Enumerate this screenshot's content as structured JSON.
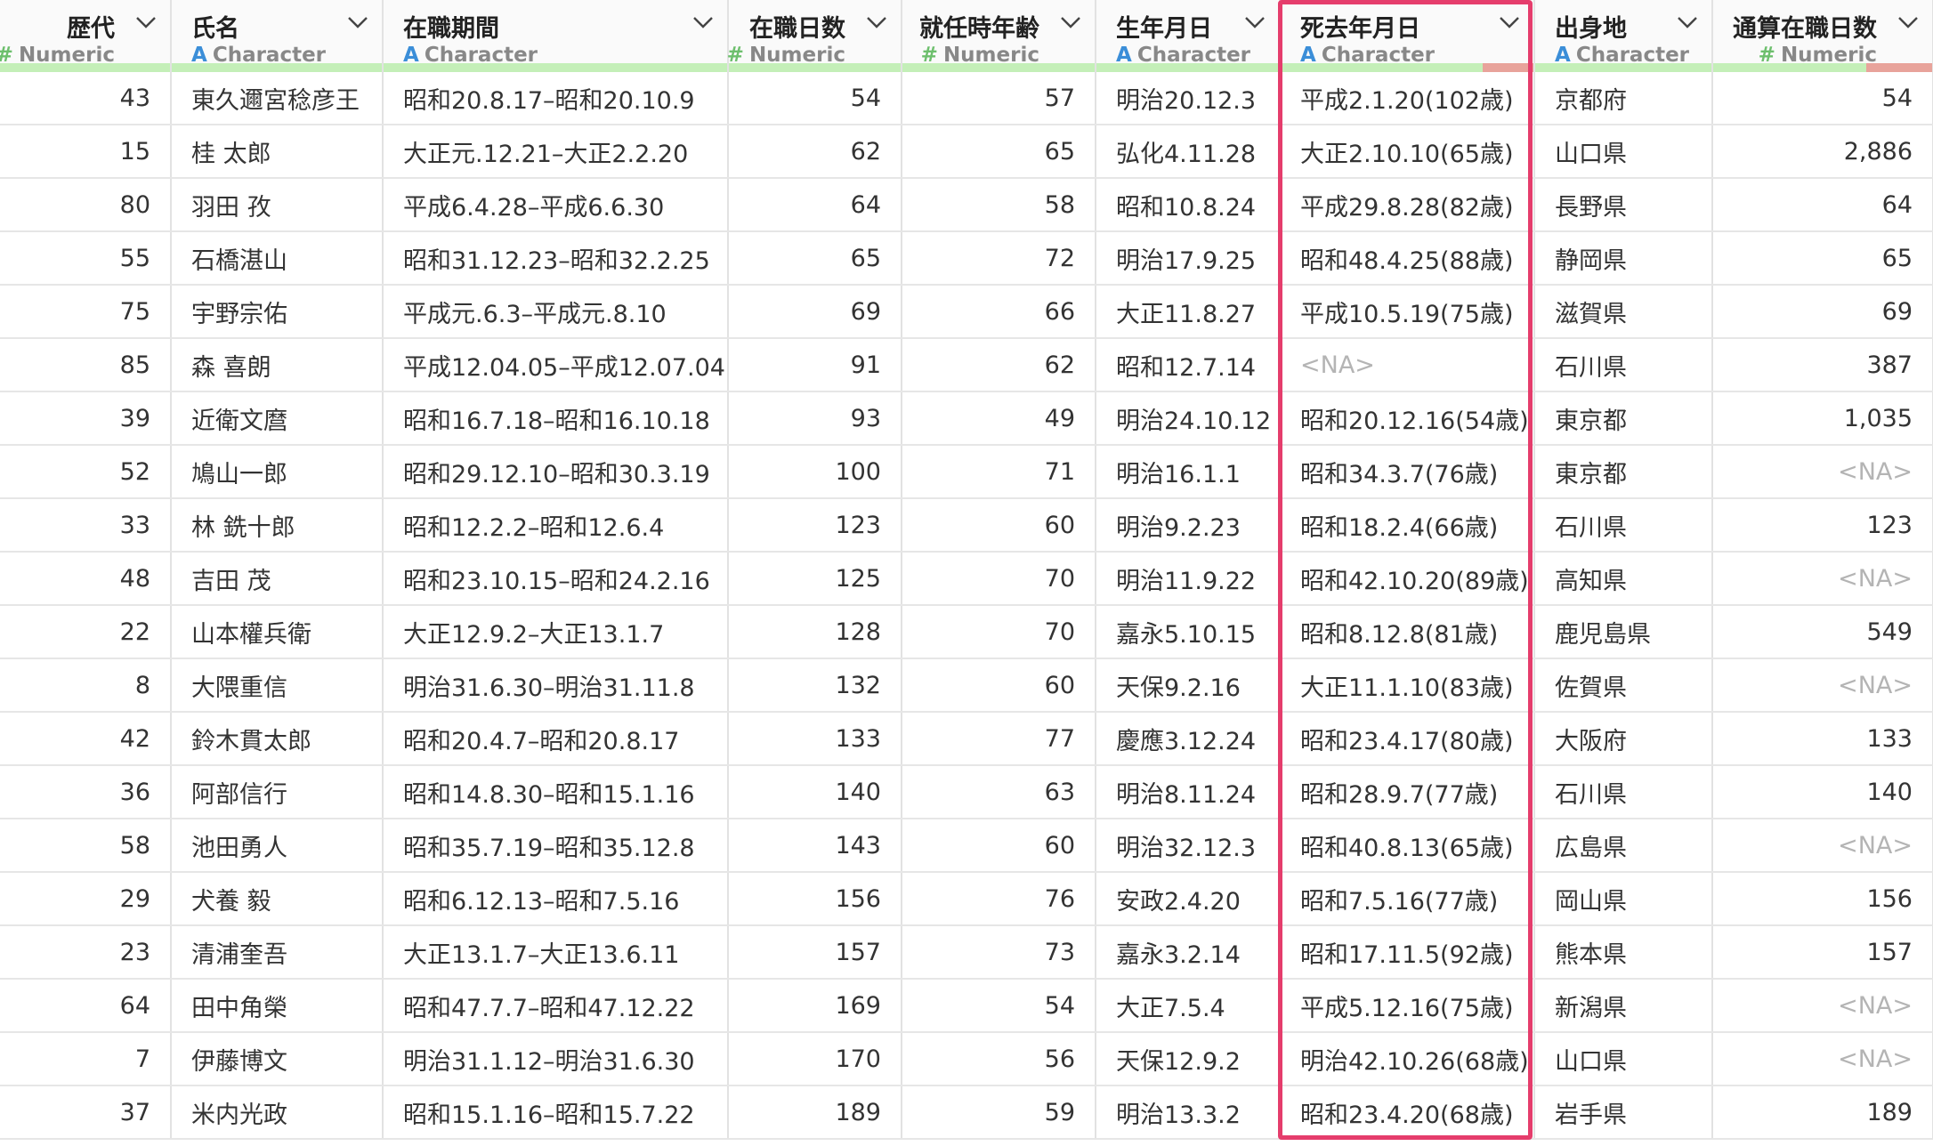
{
  "colors": {
    "numeric_icon": "#6dbf6d",
    "character_icon": "#3b8ed8",
    "quality_ok": "#c4efb8",
    "quality_missing": "#e8a39b",
    "highlight": "#e53d6c",
    "na_text": "#b4b4b4"
  },
  "type_icons": {
    "Numeric": "#",
    "Character": "A"
  },
  "columns": [
    {
      "name": "歴代",
      "type": "Numeric",
      "missing_fraction": 0,
      "header_icon": "chevron-down-icon"
    },
    {
      "name": "氏名",
      "type": "Character",
      "missing_fraction": 0,
      "header_icon": "chevron-down-icon"
    },
    {
      "name": "在職期間",
      "type": "Character",
      "missing_fraction": 0,
      "header_icon": "chevron-down-icon"
    },
    {
      "name": "在職日数",
      "type": "Numeric",
      "missing_fraction": 0,
      "header_icon": "chevron-down-icon"
    },
    {
      "name": "就任時年齢",
      "type": "Numeric",
      "missing_fraction": 0,
      "header_icon": "chevron-down-icon"
    },
    {
      "name": "生年月日",
      "type": "Character",
      "missing_fraction": 0,
      "header_icon": "chevron-down-icon"
    },
    {
      "name": "死去年月日",
      "type": "Character",
      "missing_fraction": 0.2,
      "header_icon": "chevron-down-icon"
    },
    {
      "name": "出身地",
      "type": "Character",
      "missing_fraction": 0,
      "header_icon": "chevron-down-icon"
    },
    {
      "name": "通算在職日数",
      "type": "Numeric",
      "missing_fraction": 0.3,
      "header_icon": "chevron-down-icon"
    }
  ],
  "rows": [
    [
      "43",
      "東久邇宮稔彦王",
      "昭和20.8.17–昭和20.10.9",
      "54",
      "57",
      "明治20.12.3",
      "平成2.1.20(102歳)",
      "京都府",
      "54"
    ],
    [
      "15",
      "桂 太郎",
      "大正元.12.21–大正2.2.20",
      "62",
      "65",
      "弘化4.11.28",
      "大正2.10.10(65歳)",
      "山口県",
      "2,886"
    ],
    [
      "80",
      "羽田 孜",
      "平成6.4.28–平成6.6.30",
      "64",
      "58",
      "昭和10.8.24",
      "平成29.8.28(82歳)",
      "長野県",
      "64"
    ],
    [
      "55",
      "石橋湛山",
      "昭和31.12.23–昭和32.2.25",
      "65",
      "72",
      "明治17.9.25",
      "昭和48.4.25(88歳)",
      "静岡県",
      "65"
    ],
    [
      "75",
      "宇野宗佑",
      "平成元.6.3–平成元.8.10",
      "69",
      "66",
      "大正11.8.27",
      "平成10.5.19(75歳)",
      "滋賀県",
      "69"
    ],
    [
      "85",
      "森 喜朗",
      "平成12.04.05–平成12.07.04",
      "91",
      "62",
      "昭和12.7.14",
      "<NA>",
      "石川県",
      "387"
    ],
    [
      "39",
      "近衛文麿",
      "昭和16.7.18–昭和16.10.18",
      "93",
      "49",
      "明治24.10.12",
      "昭和20.12.16(54歳)",
      "東京都",
      "1,035"
    ],
    [
      "52",
      "鳩山一郎",
      "昭和29.12.10–昭和30.3.19",
      "100",
      "71",
      "明治16.1.1",
      "昭和34.3.7(76歳)",
      "東京都",
      "<NA>"
    ],
    [
      "33",
      "林 銑十郎",
      "昭和12.2.2–昭和12.6.4",
      "123",
      "60",
      "明治9.2.23",
      "昭和18.2.4(66歳)",
      "石川県",
      "123"
    ],
    [
      "48",
      "吉田 茂",
      "昭和23.10.15–昭和24.2.16",
      "125",
      "70",
      "明治11.9.22",
      "昭和42.10.20(89歳)",
      "高知県",
      "<NA>"
    ],
    [
      "22",
      "山本權兵衛",
      "大正12.9.2–大正13.1.7",
      "128",
      "70",
      "嘉永5.10.15",
      "昭和8.12.8(81歳)",
      "鹿児島県",
      "549"
    ],
    [
      "8",
      "大隈重信",
      "明治31.6.30–明治31.11.8",
      "132",
      "60",
      "天保9.2.16",
      "大正11.1.10(83歳)",
      "佐賀県",
      "<NA>"
    ],
    [
      "42",
      "鈴木貫太郎",
      "昭和20.4.7–昭和20.8.17",
      "133",
      "77",
      "慶應3.12.24",
      "昭和23.4.17(80歳)",
      "大阪府",
      "133"
    ],
    [
      "36",
      "阿部信行",
      "昭和14.8.30–昭和15.1.16",
      "140",
      "63",
      "明治8.11.24",
      "昭和28.9.7(77歳)",
      "石川県",
      "140"
    ],
    [
      "58",
      "池田勇人",
      "昭和35.7.19–昭和35.12.8",
      "143",
      "60",
      "明治32.12.3",
      "昭和40.8.13(65歳)",
      "広島県",
      "<NA>"
    ],
    [
      "29",
      "犬養 毅",
      "昭和6.12.13–昭和7.5.16",
      "156",
      "76",
      "安政2.4.20",
      "昭和7.5.16(77歳)",
      "岡山県",
      "156"
    ],
    [
      "23",
      "清浦奎吾",
      "大正13.1.7–大正13.6.11",
      "157",
      "73",
      "嘉永3.2.14",
      "昭和17.11.5(92歳)",
      "熊本県",
      "157"
    ],
    [
      "64",
      "田中角榮",
      "昭和47.7.7–昭和47.12.22",
      "169",
      "54",
      "大正7.5.4",
      "平成5.12.16(75歳)",
      "新潟県",
      "<NA>"
    ],
    [
      "7",
      "伊藤博文",
      "明治31.1.12–明治31.6.30",
      "170",
      "56",
      "天保12.9.2",
      "明治42.10.26(68歳)",
      "山口県",
      "<NA>"
    ],
    [
      "37",
      "米内光政",
      "昭和15.1.16–昭和15.7.22",
      "189",
      "59",
      "明治13.3.2",
      "昭和23.4.20(68歳)",
      "岩手県",
      "189"
    ]
  ]
}
